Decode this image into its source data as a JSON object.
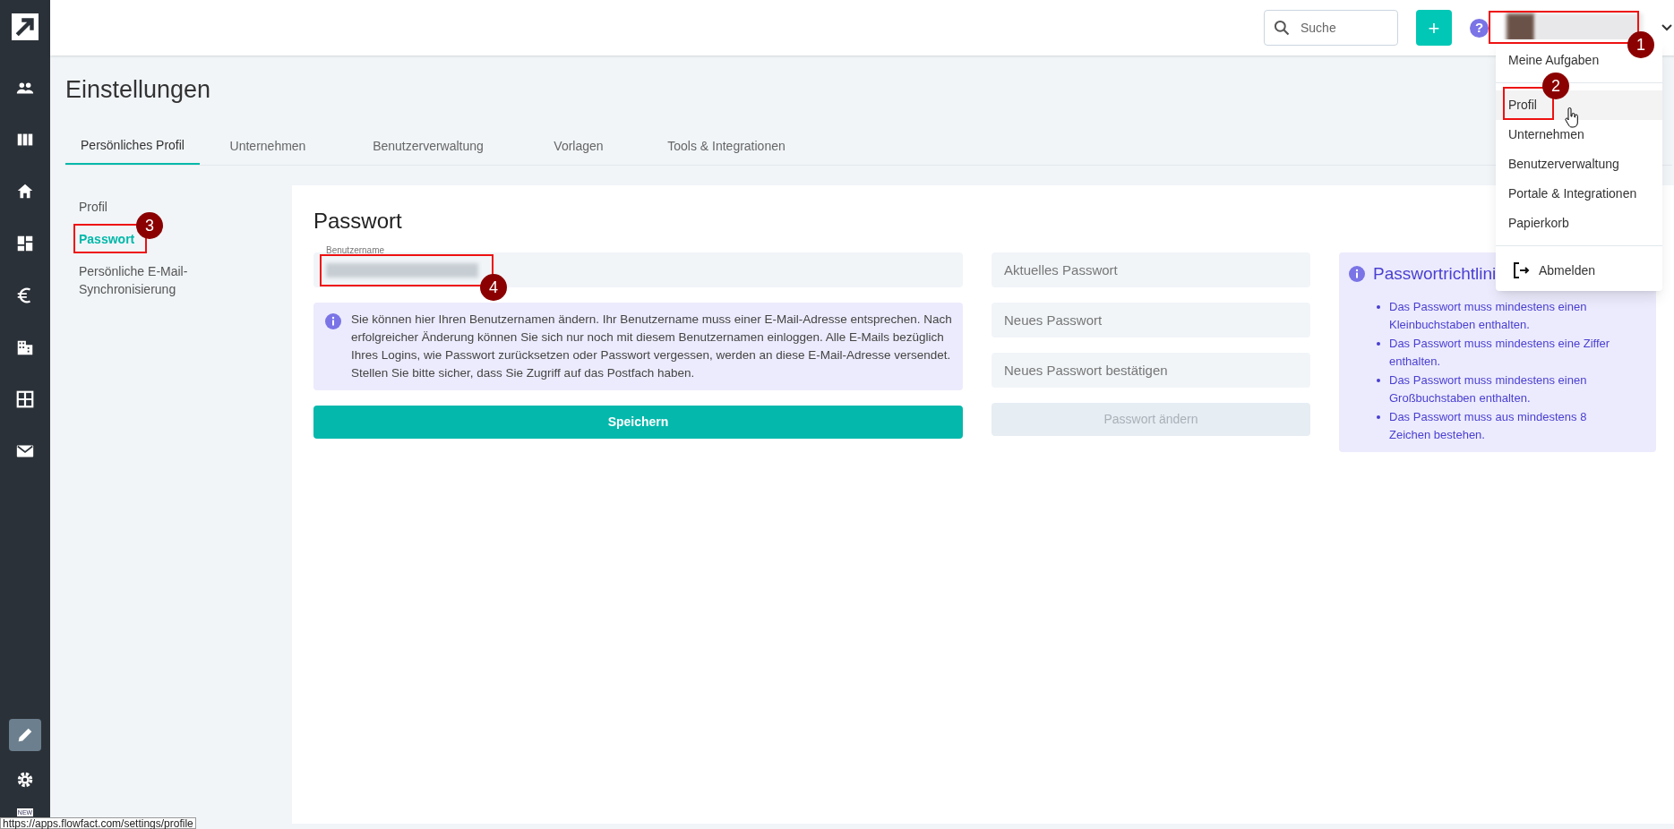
{
  "sidebar": {
    "items": [
      {
        "kind": "logo",
        "selected": false
      },
      {
        "kind": "people",
        "selected": false
      },
      {
        "kind": "columns",
        "selected": false
      },
      {
        "kind": "home",
        "selected": false
      },
      {
        "kind": "dashboard",
        "selected": false
      },
      {
        "kind": "euro",
        "selected": false
      },
      {
        "kind": "building",
        "selected": false
      },
      {
        "kind": "grid",
        "selected": false
      },
      {
        "kind": "mail",
        "selected": false
      }
    ],
    "bottom_items": [
      {
        "kind": "pencil",
        "selected": true
      },
      {
        "kind": "gear",
        "selected": false
      }
    ],
    "badge": "NEW"
  },
  "topbar": {
    "search": {
      "placeholder": "Suche"
    },
    "add_button": "+",
    "help_button": "?"
  },
  "user_menu": {
    "items": [
      {
        "kind": "item",
        "label": "Meine Aufgaben",
        "selected": false
      },
      {
        "kind": "divider"
      },
      {
        "kind": "item",
        "label": "Profil",
        "selected": true
      },
      {
        "kind": "item",
        "label": "Unternehmen",
        "selected": false
      },
      {
        "kind": "item",
        "label": "Benutzerverwaltung",
        "selected": false
      },
      {
        "kind": "item",
        "label": "Portale & Integrationen",
        "selected": false
      },
      {
        "kind": "item",
        "label": "Papierkorb",
        "selected": false
      },
      {
        "kind": "divider"
      },
      {
        "kind": "logout",
        "label": "Abmelden",
        "selected": false
      }
    ]
  },
  "page": {
    "title": "Einstellungen"
  },
  "tabs": [
    {
      "label": "Persönliches Profil",
      "selected": true
    },
    {
      "label": "Unternehmen",
      "selected": false
    },
    {
      "label": "Benutzerverwaltung",
      "selected": false
    },
    {
      "label": "Vorlagen",
      "selected": false
    },
    {
      "label": "Tools & Integrationen",
      "selected": false
    }
  ],
  "subnav": [
    {
      "label": "Profil",
      "selected": false
    },
    {
      "label": "Passwort",
      "selected": true
    },
    {
      "label": "Persönliche E-Mail-Synchronisierung",
      "selected": false
    }
  ],
  "card": {
    "title": "Passwort",
    "username_field": {
      "label": "Benutzername"
    },
    "info": "Sie können hier Ihren Benutzernamen ändern. Ihr Benutzername muss einer E-Mail-Adresse entsprechen. Nach erfolgreicher Änderung können Sie sich nur noch mit diesem Benutzernamen einloggen. Alle E-Mails bezüglich Ihres Logins, wie Passwort zurücksetzen oder Passwort vergessen, werden an diese E-Mail-Adresse versendet. Stellen Sie bitte sicher, dass Sie Zugriff auf das Postfach haben.",
    "save_button": {
      "label": "Speichern",
      "disabled": false
    },
    "password_fields": [
      {
        "placeholder": "Aktuelles Passwort"
      },
      {
        "placeholder": "Neues Passwort"
      },
      {
        "placeholder": "Neues Passwort bestätigen"
      }
    ],
    "change_button": {
      "label": "Passwort ändern",
      "disabled": true
    },
    "policy": {
      "title": "Passwortrichtlini",
      "rules": [
        "Das Passwort muss mindestens einen Kleinbuchstaben enthalten.",
        "Das Passwort muss mindestens eine Ziffer enthalten.",
        "Das Passwort muss mindestens einen Großbuchstaben enthalten.",
        "Das Passwort muss aus mindestens 8 Zeichen bestehen."
      ]
    }
  },
  "annotations": [
    {
      "label": "1"
    },
    {
      "label": "2"
    },
    {
      "label": "3"
    },
    {
      "label": "4"
    }
  ],
  "status_url": "https://apps.flowfact.com/settings/profile"
}
